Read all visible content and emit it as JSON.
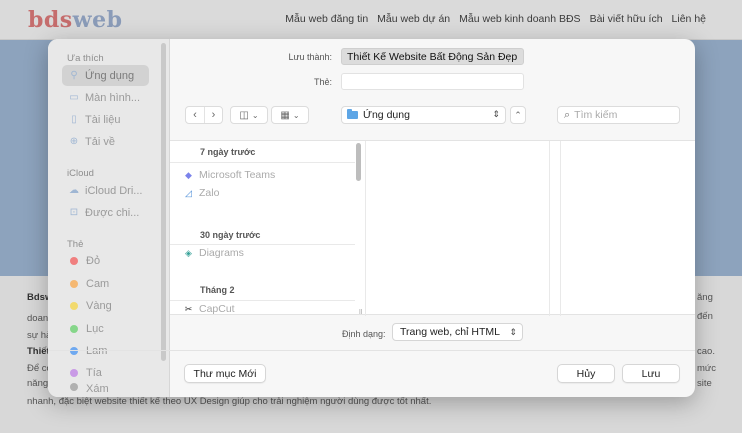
{
  "site": {
    "logo_a": "bds",
    "logo_b": "web",
    "nav": [
      "Mẫu web đăng tin",
      "Mẫu web dự án",
      "Mẫu web kinh doanh BĐS",
      "Bài viết hữu ích",
      "Liên hệ"
    ],
    "lines": [
      "Bdsw",
      "ăng",
      "doanh",
      "đến",
      "sự hà",
      "Thiết",
      "cao.",
      "Để có",
      "mức",
      "năng",
      "site",
      "nhanh, đặc biệt website thiết kế theo UX Design giúp cho trải nghiệm người dùng được tốt nhất."
    ]
  },
  "sidebar": {
    "favorites_title": "Ưa thích",
    "favorites": [
      {
        "label": "Ứng dụng",
        "icon": "applications-icon",
        "glyph": "⚲"
      },
      {
        "label": "Màn hình...",
        "icon": "desktop-icon",
        "glyph": "▭"
      },
      {
        "label": "Tài liệu",
        "icon": "document-icon",
        "glyph": "▯"
      },
      {
        "label": "Tải về",
        "icon": "download-icon",
        "glyph": "⊕"
      }
    ],
    "icloud_title": "iCloud",
    "icloud": [
      {
        "label": "iCloud Dri...",
        "icon": "cloud-icon",
        "glyph": "☁"
      },
      {
        "label": "Được chi...",
        "icon": "shared-folder-icon",
        "glyph": "⊡"
      }
    ],
    "tags_title": "Thẻ",
    "tags": [
      {
        "label": "Đỏ",
        "color": "#f07f7f"
      },
      {
        "label": "Cam",
        "color": "#f5b872"
      },
      {
        "label": "Vàng",
        "color": "#f2da6e"
      },
      {
        "label": "Lục",
        "color": "#86d68a"
      },
      {
        "label": "Lam",
        "color": "#6fa9f0"
      },
      {
        "label": "Tía",
        "color": "#c99ae6"
      },
      {
        "label": "Xám",
        "color": "#b0b0b0"
      }
    ]
  },
  "form": {
    "save_as_label": "Lưu thành:",
    "save_as_value": "Thiết Kế Website Bất Động Sản Đẹp",
    "tags_label": "Thẻ:",
    "location": "Ứng dụng",
    "search_placeholder": "Tìm kiếm"
  },
  "browser": {
    "groups": [
      {
        "title": "7 ngày trước",
        "files": [
          {
            "name": "Microsoft Teams",
            "glyph": "◆",
            "color": "#7b83eb"
          },
          {
            "name": "Zalo",
            "glyph": "◿",
            "color": "#4f8fd9"
          }
        ]
      },
      {
        "title": "30 ngày trước",
        "files": [
          {
            "name": "Diagrams",
            "glyph": "◈",
            "color": "#3aa39a"
          }
        ]
      },
      {
        "title": "Tháng 2",
        "files": [
          {
            "name": "CapCut",
            "glyph": "✂",
            "color": "#333333"
          }
        ]
      }
    ]
  },
  "footer": {
    "format_label": "Định dạng:",
    "format_value": "Trang web, chỉ HTML",
    "new_folder": "Thư mục Mới",
    "cancel": "Hủy",
    "save": "Lưu"
  }
}
